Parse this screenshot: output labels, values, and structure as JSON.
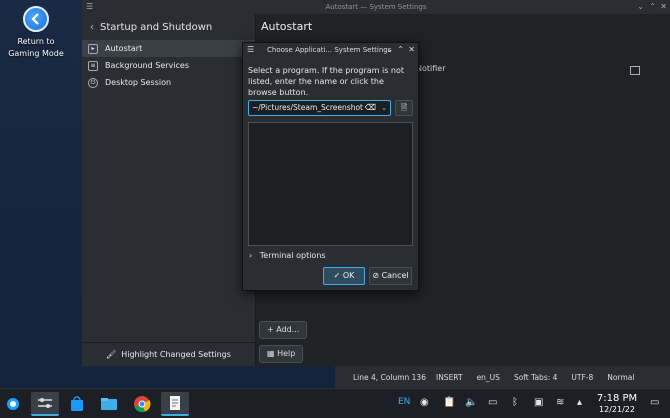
{
  "desktop": {
    "return_label_line1": "Return to",
    "return_label_line2": "Gaming Mode"
  },
  "window": {
    "title": "Autostart — System Settings"
  },
  "sidebar": {
    "header": "Startup and Shutdown",
    "items": [
      {
        "label": "Autostart"
      },
      {
        "label": "Background Services"
      },
      {
        "label": "Desktop Session"
      }
    ],
    "footer": "Highlight Changed Settings"
  },
  "main": {
    "title": "Autostart",
    "notifier_text": "Notifier",
    "add_button": "Add...",
    "help_button": "Help"
  },
  "dialog": {
    "title": "Choose Applicati... System Settings",
    "prompt": "Select a program. If the program is not listed, enter the name or click the browse button.",
    "input_value": "~/Pictures/Steam_Screenshots/",
    "terminal_options": "Terminal options",
    "ok_label": "OK",
    "cancel_label": "Cancel"
  },
  "statusbar": {
    "position": "Line 4, Column 136",
    "mode": "INSERT",
    "language": "en_US",
    "tabs": "Soft Tabs: 4",
    "encoding": "UTF-8",
    "highlight": "Normal"
  },
  "taskbar": {
    "keyboard_layout": "EN",
    "time": "7:18 PM",
    "date": "12/21/22"
  },
  "colors": {
    "accent": "#3daee9",
    "window_bg": "#2a2e32",
    "content_bg": "#202326",
    "desktop_bg": "#17253c"
  }
}
